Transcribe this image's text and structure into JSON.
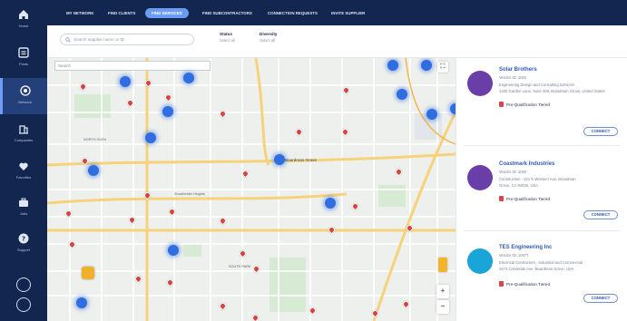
{
  "sidebar": {
    "items": [
      {
        "label": "Home",
        "icon": "home-icon"
      },
      {
        "label": "Posts",
        "icon": "posts-icon"
      },
      {
        "label": "Network",
        "icon": "network-icon"
      },
      {
        "label": "Companies",
        "icon": "companies-icon"
      },
      {
        "label": "Favorites",
        "icon": "favorites-icon"
      },
      {
        "label": "Jobs",
        "icon": "jobs-icon"
      },
      {
        "label": "Support",
        "icon": "support-icon"
      }
    ],
    "active_index": 2
  },
  "topbar": {
    "tabs": [
      {
        "label": "MY NETWORK"
      },
      {
        "label": "FIND CLIENTS"
      },
      {
        "label": "FIND SERVICES"
      },
      {
        "label": "FIND SUBCONTRACTORS"
      },
      {
        "label": "CONNECTION REQUESTS"
      },
      {
        "label": "INVITE SUPPLIER"
      }
    ],
    "active_index": 2
  },
  "filters": {
    "search_placeholder": "Search supplier name or ID",
    "state": {
      "label": "Status",
      "value": "Select all"
    },
    "diversity": {
      "label": "Diversity",
      "value": "Select all"
    }
  },
  "map": {
    "search_placeholder": "Search",
    "labels": {
      "city_main": "Boardman Grove",
      "city_secondary": "Snowbelder Heights",
      "district_1": "NORTH GLEN",
      "district_2": "SOUTH PARK"
    },
    "zoom_in": "+",
    "zoom_out": "−"
  },
  "results": {
    "cards": [
      {
        "name": "Solar Brothers",
        "id": "Vendor ID: 1001",
        "address": "Engineering Design and Consulting Services",
        "address2": "1200 Garden Lane, Suite 400, Boardman Grove, United States",
        "badge": "Pre-Qualification Tiered",
        "connect": "CONNECT",
        "logo_color": "#6a3ea8"
      },
      {
        "name": "Coastmark Industries",
        "id": "Vendor ID: 1002",
        "address": "Construction - 221 E Western Ave, Boardman",
        "address2": "Grove, CA 94025, USA",
        "badge": "Pre-Qualification Tiered",
        "connect": "CONNECT",
        "logo_color": "#6a3ea8"
      },
      {
        "name": "TES Engineering Inc",
        "id": "Vendor ID: 10077",
        "address": "Electrical Contractors - Industrial and Commercial",
        "address2": "1572 Creekside Ave, Boardman Grove, USA",
        "badge": "Pre-Qualification Tiered",
        "connect": "CONNECT",
        "logo_color": "#1aa5d8"
      }
    ]
  },
  "colors": {
    "navy": "#12264f",
    "accent": "#6b9cf4",
    "pin_red": "#d9423e",
    "cluster_blue": "#2f6de0"
  }
}
